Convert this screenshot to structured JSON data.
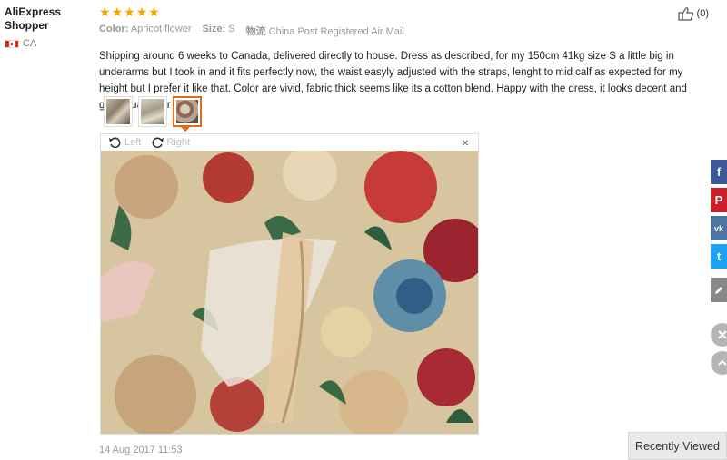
{
  "buyer": {
    "name_line1": "AliExpress",
    "name_line2": "Shopper",
    "country": "CA"
  },
  "rating": {
    "stars": 5
  },
  "attributes": [
    {
      "key": "Color:",
      "value": "Apricot flower"
    },
    {
      "key": "Size:",
      "value": "S"
    },
    {
      "key": "物流",
      "value": "China Post Registered Air Mail"
    }
  ],
  "helpful": {
    "count": "(0)"
  },
  "review": {
    "text": "Shipping around 6 weeks to Canada, delivered directly to house. Dress as described, for my 150cm 41kg size S a little big in underarms but I took in and it fits perfectly now, the waist easyly adjusted with the straps, lenght to mid calf as expected for my height but I prefer it like that. Color are vivid, fabric thick seems like its a cotton blend. Happy with the dress, it looks decent and good quality for price.",
    "date": "14 Aug 2017 11:53"
  },
  "viewer": {
    "rotate_left": "Left",
    "rotate_right": "Right",
    "close": "×"
  },
  "colors": {
    "accent": "#e06c1a",
    "star": "#f7a600",
    "facebook": "#3b5998",
    "pinterest": "#cb2027",
    "vk": "#4c75a3",
    "twitter": "#1da1f2"
  },
  "share": {
    "facebook": "f",
    "pinterest": "P",
    "vk": "vk",
    "twitter": "t"
  },
  "recently_viewed": "Recently Viewed"
}
